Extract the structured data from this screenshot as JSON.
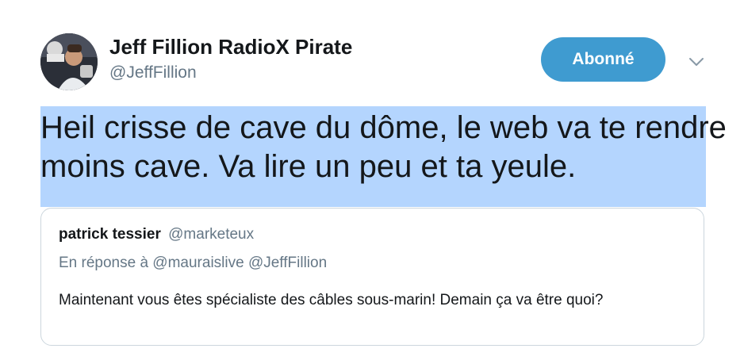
{
  "author": {
    "display_name": "Jeff Fillion RadioX Pirate",
    "handle": "@JeffFillion",
    "avatar_icon": "profile-photo"
  },
  "follow_button": {
    "label": "Abonné",
    "color": "#3f9bd0"
  },
  "menu_caret_icon": "chevron-down-icon",
  "tweet": {
    "text": "Heil crisse de cave du dôme, le web va te rendre moins cave. Va lire un peu et ta yeule.",
    "selection_color": "#b4d5fe"
  },
  "quoted_tweet": {
    "display_name": "patrick tessier",
    "handle": "@marketeux",
    "reply_context": "En réponse à @mauraislive @JeffFillion",
    "text": "Maintenant vous êtes spécialiste des câbles sous-marin! Demain ça va être quoi?"
  }
}
